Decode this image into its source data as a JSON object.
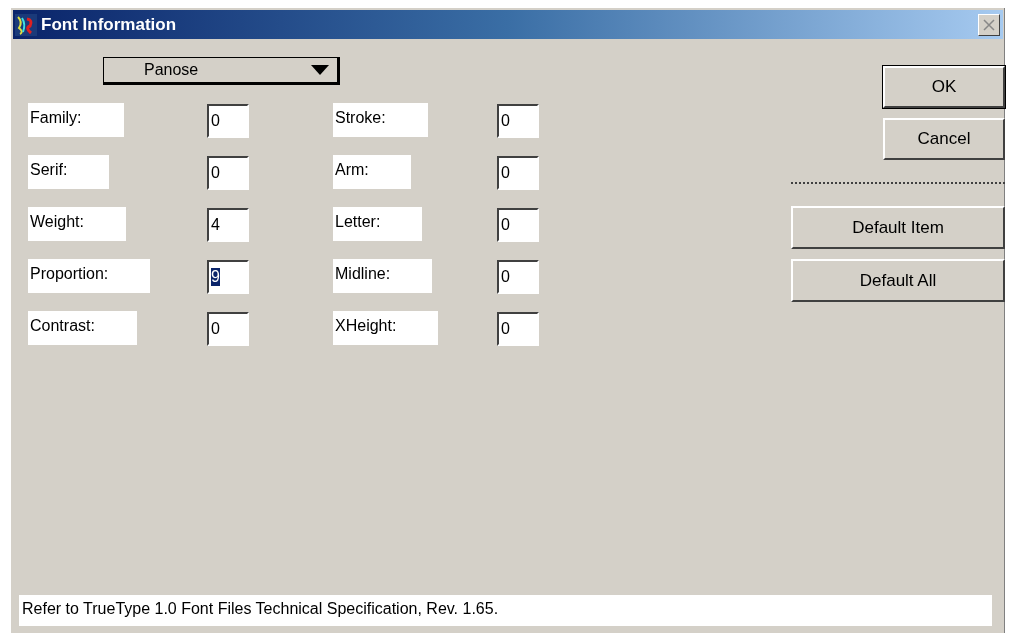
{
  "window": {
    "title": "Font Information"
  },
  "dropdown": {
    "value": "Panose"
  },
  "fields": [
    {
      "label": "Family:",
      "value": "0",
      "selected": false
    },
    {
      "label": "Stroke:",
      "value": "0",
      "selected": false
    },
    {
      "label": "Serif:",
      "value": "0",
      "selected": false
    },
    {
      "label": "Arm:",
      "value": "0",
      "selected": false
    },
    {
      "label": "Weight:",
      "value": "4",
      "selected": false
    },
    {
      "label": "Letter:",
      "value": "0",
      "selected": false
    },
    {
      "label": "Proportion:",
      "value": "9",
      "selected": true
    },
    {
      "label": "Midline:",
      "value": "0",
      "selected": false
    },
    {
      "label": "Contrast:",
      "value": "0",
      "selected": false
    },
    {
      "label": "XHeight:",
      "value": "0",
      "selected": false
    }
  ],
  "buttons": [
    {
      "label": "OK",
      "default": true
    },
    {
      "label": "Cancel",
      "default": false
    }
  ],
  "default_buttons": [
    {
      "label": "Default Item"
    },
    {
      "label": "Default All"
    }
  ],
  "status": "Refer to TrueType 1.0 Font Files Technical Specification, Rev. 1.65."
}
